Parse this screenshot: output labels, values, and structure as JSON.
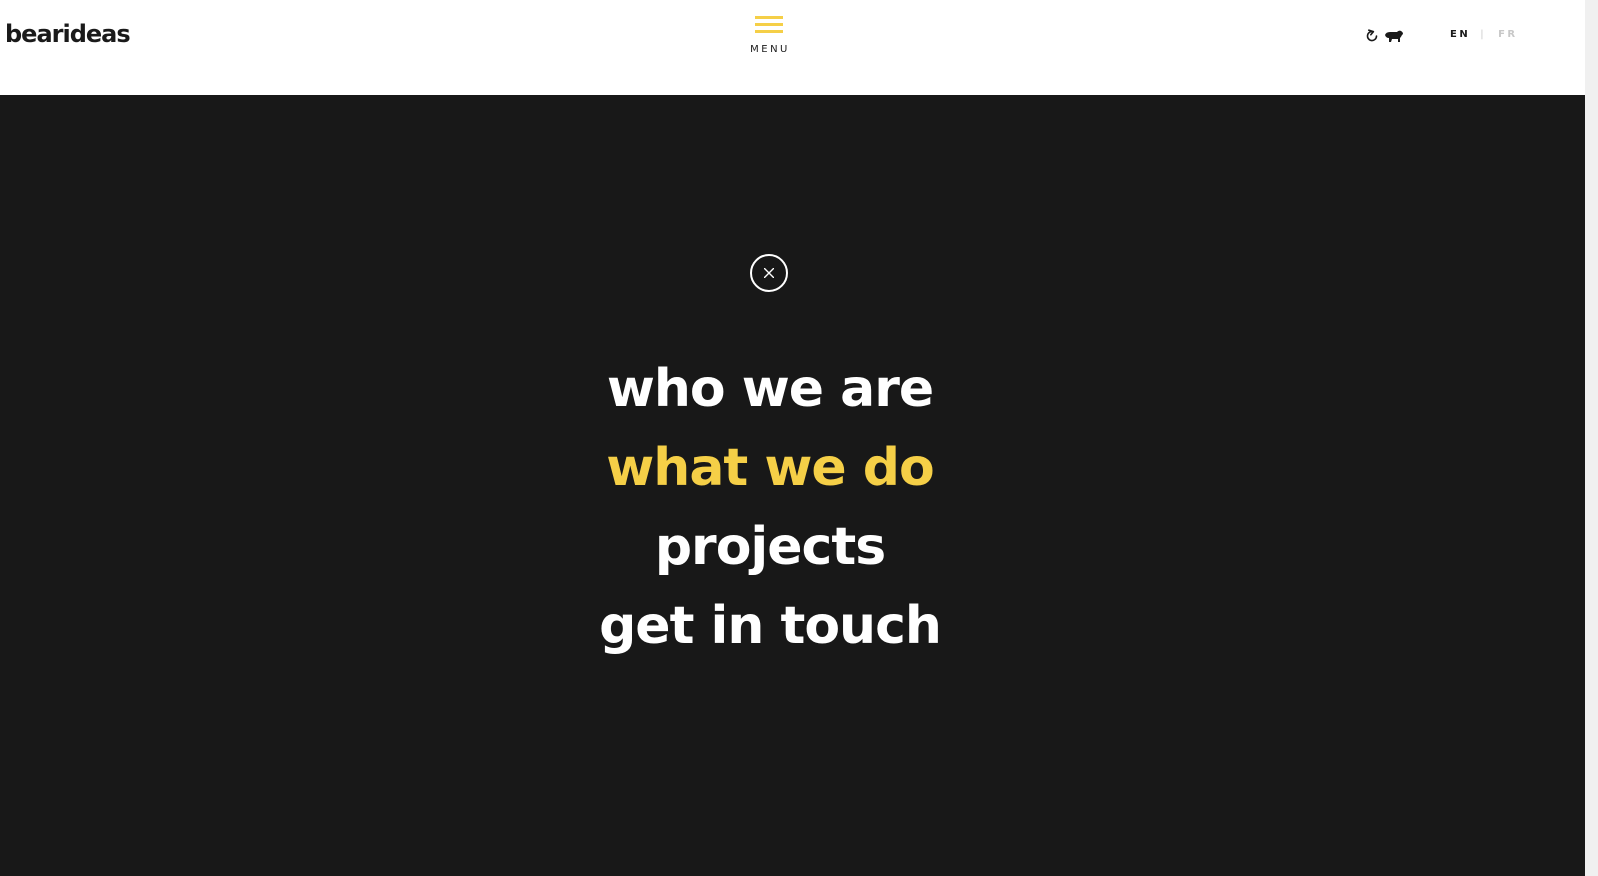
{
  "header": {
    "logo": "bearideas",
    "menu_label": "MENU",
    "icons": [
      "refresh-icon",
      "bear-icon"
    ],
    "languages": [
      {
        "code": "EN",
        "active": true
      },
      {
        "code": "FR",
        "active": false
      }
    ],
    "language_separator": "|"
  },
  "overlay": {
    "close_icon": "close-icon",
    "nav": [
      {
        "label": "who we are",
        "active": false
      },
      {
        "label": "what we do",
        "active": true
      },
      {
        "label": "projects",
        "active": false
      },
      {
        "label": "get in touch",
        "active": false
      }
    ]
  },
  "colors": {
    "accent": "#f5cf47",
    "overlay_bg": "#181818",
    "header_bg": "#ffffff",
    "text_dark": "#1a1a1a",
    "text_light": "#ffffff",
    "inactive_lang": "#c8c8c8"
  }
}
